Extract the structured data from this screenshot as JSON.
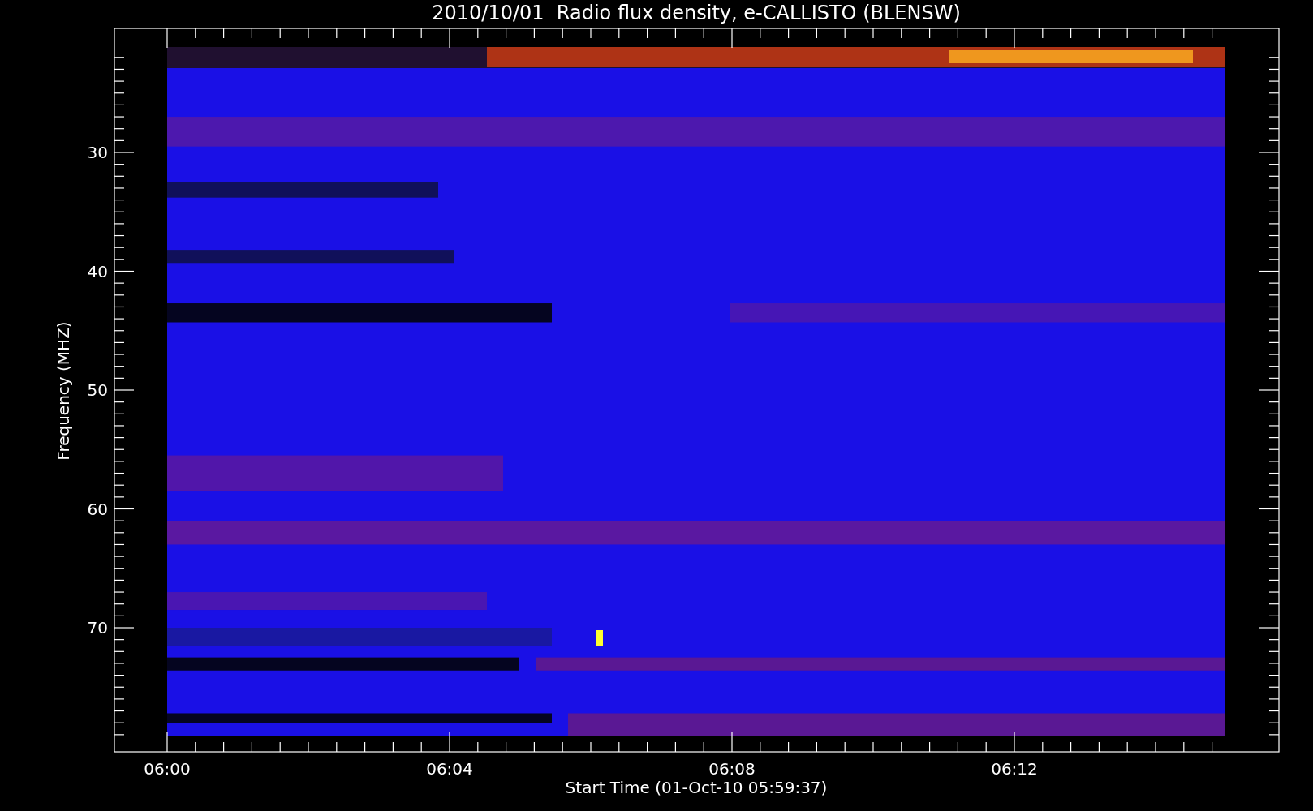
{
  "title": "2010/10/01  Radio flux density, e-CALLISTO (BLENSW)",
  "y_axis": {
    "label": "Frequency (MHZ)",
    "ticks": [
      "30",
      "40",
      "50",
      "60",
      "70"
    ]
  },
  "x_axis": {
    "label": "Start Time (01-Oct-10 05:59:37)",
    "ticks": [
      "06:00",
      "06:04",
      "06:08",
      "06:12"
    ]
  }
}
